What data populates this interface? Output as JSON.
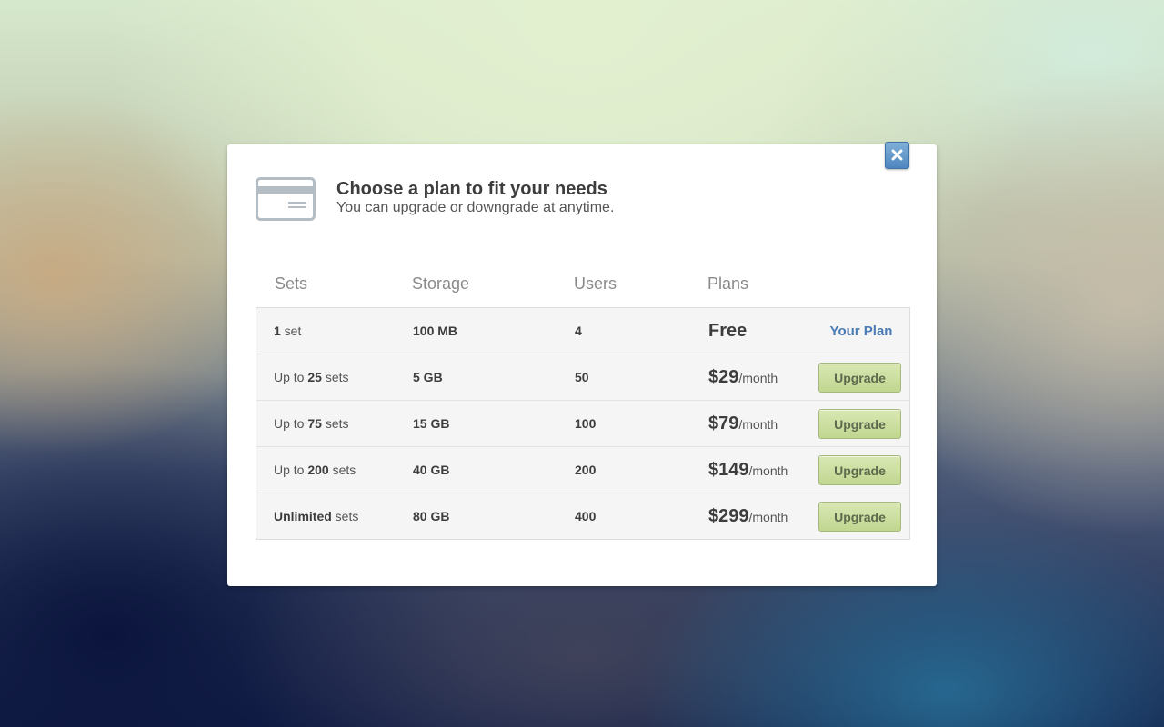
{
  "modal": {
    "title": "Choose a plan to fit your needs",
    "subtitle": "You can upgrade or downgrade at anytime."
  },
  "icons": {
    "close": "close-icon",
    "card": "credit-card-icon"
  },
  "colors": {
    "accent": "#4a7bb5",
    "upgrade_button": "#c9dc9c",
    "close_button": "#5f93c8"
  },
  "table": {
    "headers": [
      "Sets",
      "Storage",
      "Users",
      "Plans"
    ],
    "rows": [
      {
        "sets_pre": "",
        "sets_bold": "1",
        "sets_post": " set",
        "storage": "100 MB",
        "users": "4",
        "price": "Free",
        "unit": "",
        "action": "Your Plan"
      },
      {
        "sets_pre": "Up to ",
        "sets_bold": "25",
        "sets_post": " sets",
        "storage": "5 GB",
        "users": "50",
        "price": "$29",
        "unit": "/month",
        "action": "Upgrade"
      },
      {
        "sets_pre": "Up to ",
        "sets_bold": "75",
        "sets_post": " sets",
        "storage": "15 GB",
        "users": "100",
        "price": "$79",
        "unit": "/month",
        "action": "Upgrade"
      },
      {
        "sets_pre": "Up to ",
        "sets_bold": "200",
        "sets_post": " sets",
        "storage": "40 GB",
        "users": "200",
        "price": "$149",
        "unit": "/month",
        "action": "Upgrade"
      },
      {
        "sets_pre": "",
        "sets_bold": "Unlimited",
        "sets_post": " sets",
        "storage": "80 GB",
        "users": "400",
        "price": "$299",
        "unit": "/month",
        "action": "Upgrade"
      }
    ]
  }
}
